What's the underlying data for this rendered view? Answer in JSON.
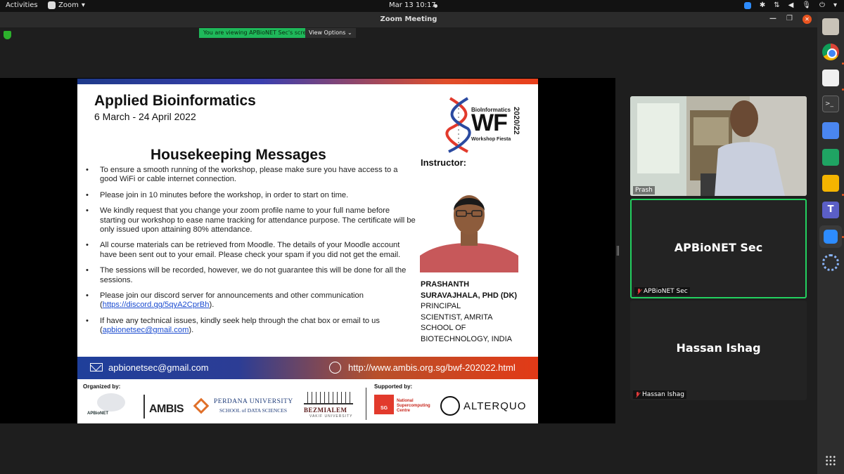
{
  "topbar": {
    "activities": "Activities",
    "app_menu": "Zoom",
    "clock": "Mar 13  10:17"
  },
  "window": {
    "title": "Zoom Meeting",
    "viewing_banner": "You are viewing APBioNET Sec's screen",
    "view_options": "View Options"
  },
  "slide": {
    "course_title": "Applied Bioinformatics",
    "course_dates": "6 March - 24 April 2022",
    "logo": {
      "top": "BioInformatics",
      "main": "WF",
      "bottom": "Workshop Fiesta",
      "year": "2020/22"
    },
    "heading": "Housekeeping Messages",
    "instructor_label": "Instructor:",
    "bullets": [
      "To ensure a smooth running of the workshop, please make sure you have access to a good WiFi or cable internet connection.",
      "Please join in 10 minutes before the workshop, in order to start on time.",
      "We kindly request that you change your zoom profile name to your full name before starting our workshop to ease name tracking for attendance purpose. The certificate will be only issued upon attaining 80% attendance.",
      "All course materials can be retrieved from Moodle. The details of your Moodle account have been sent out to your email. Please check your spam if you did not get the email.",
      "The sessions will be recorded, however, we do not guarantee this will be done for all the sessions."
    ],
    "discord": {
      "text": "Please join our discord server for announcements and other communication",
      "link": "https://discord.gg/5qyA2CprBh"
    },
    "support": {
      "text": "If have any technical issues, kindly seek help through the chat box or email to us",
      "link": "apbionetsec@gmail.com"
    },
    "instructor_name_1": "PRASHANTH",
    "instructor_name_2": "SURAVAJHALA, PHD (DK)",
    "instructor_role": [
      "PRINCIPAL",
      "SCIENTIST, AMRITA",
      "SCHOOL OF",
      "BIOTECHNOLOGY, INDIA"
    ],
    "banner_email": "apbionetsec@gmail.com",
    "banner_url": "http://www.ambis.org.sg/bwf-202022.html",
    "organized_by": "Organized by:",
    "supported_by": "Supported by:",
    "logos": {
      "apbionet": "APBioNET",
      "ambis": "AMBIS",
      "perdana_1": "PERDANA UNIVERSITY",
      "perdana_2": "SCHOOL of DATA SCIENCES",
      "bezmialem": "BEZMIALEM",
      "bezmialem_sub": "VAKIF UNIVERSITY",
      "nscc_box": "SG",
      "nscc": [
        "National",
        "Supercomputing",
        "Centre"
      ],
      "alterquo": "ALTERQUO"
    }
  },
  "participants": [
    {
      "name": "Prash",
      "video": true
    },
    {
      "name": "APBioNET Sec",
      "muted": true,
      "active_speaker": true
    },
    {
      "name": "Hassan Ishag",
      "muted": true
    }
  ],
  "colors": {
    "active_speaker_border": "#23d160",
    "viewing_banner": "#1fb85a",
    "banner_left": "#1f3f9a",
    "banner_right": "#e23a17"
  },
  "dock": {
    "icons": [
      "files-icon",
      "chrome-icon",
      "text-editor-icon",
      "terminal-icon",
      "docs-icon",
      "sheets-icon",
      "slides-icon",
      "teams-icon",
      "zoom-icon",
      "ring-icon",
      "app-grid-icon"
    ]
  }
}
